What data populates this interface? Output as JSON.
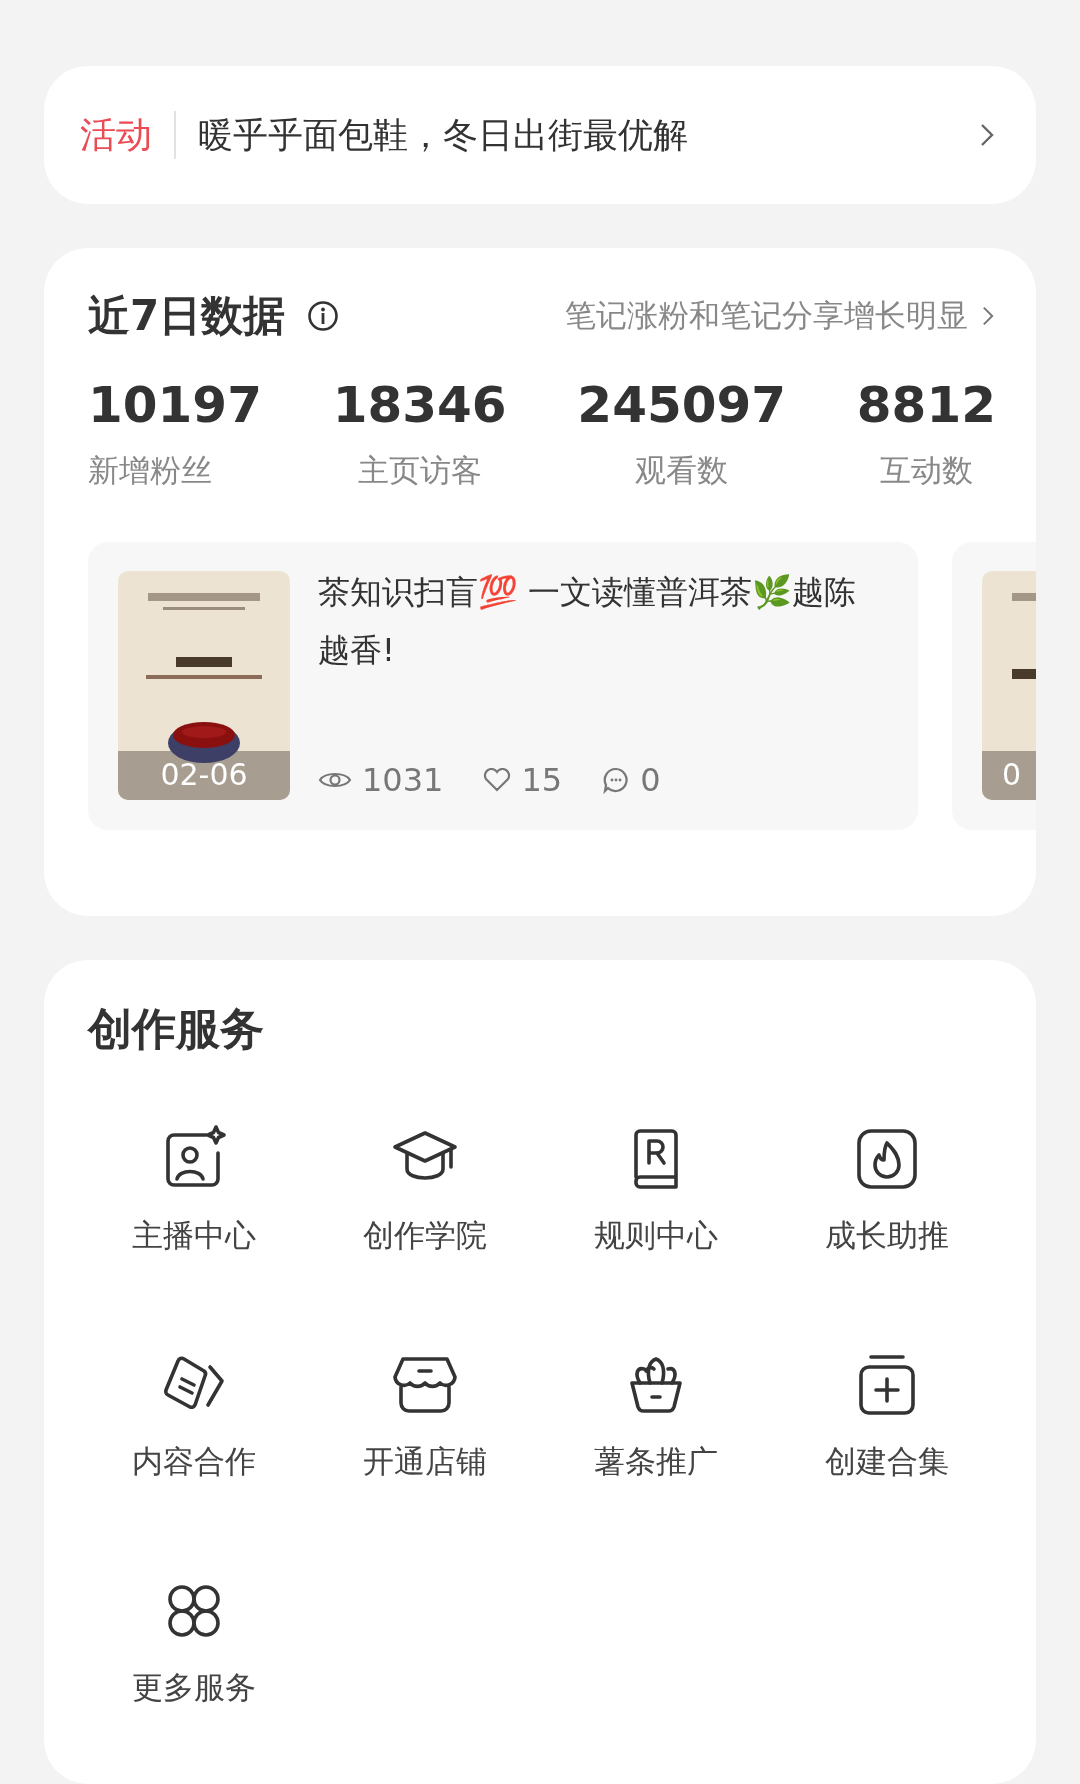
{
  "activity": {
    "tag": "活动",
    "text": "暖乎乎面包鞋，冬日出街最优解"
  },
  "stats": {
    "title": "近7日数据",
    "hint": "笔记涨粉和笔记分享增长明显",
    "metrics": [
      {
        "value": "10197",
        "label": "新增粉丝"
      },
      {
        "value": "18346",
        "label": "主页访客"
      },
      {
        "value": "245097",
        "label": "观看数"
      },
      {
        "value": "8812",
        "label": "互动数"
      }
    ],
    "notes": [
      {
        "kind": "full",
        "title": "茶知识扫盲💯 一文读懂普洱茶🌿越陈越香!",
        "date": "02-06",
        "views": "1031",
        "likes": "15",
        "comments": "0"
      },
      {
        "kind": "peek",
        "date": "0"
      }
    ]
  },
  "services": {
    "title": "创作服务",
    "items": [
      {
        "kind": "host",
        "label": "主播中心"
      },
      {
        "kind": "academy",
        "label": "创作学院"
      },
      {
        "kind": "rules",
        "label": "规则中心"
      },
      {
        "kind": "growth",
        "label": "成长助推"
      },
      {
        "kind": "collab",
        "label": "内容合作"
      },
      {
        "kind": "shop",
        "label": "开通店铺"
      },
      {
        "kind": "promo",
        "label": "薯条推广"
      },
      {
        "kind": "collection",
        "label": "创建合集"
      },
      {
        "kind": "more",
        "label": "更多服务"
      }
    ]
  }
}
